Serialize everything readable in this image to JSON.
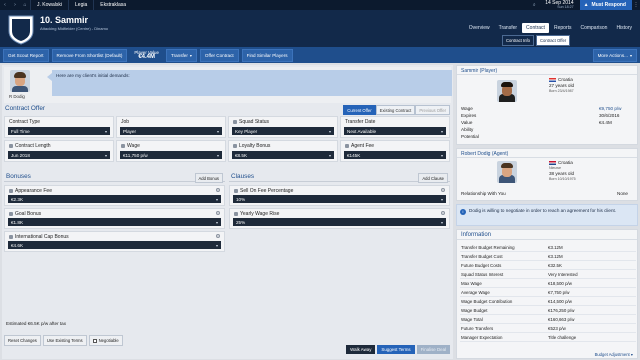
{
  "topbar": {
    "crumbs": [
      "J. Kowalski",
      "Legia",
      "Ekstraklasa"
    ],
    "date_line1": "14 Sep 2014",
    "date_line2": "Sun 18:27",
    "continue_label": "Must Respond",
    "continue_icon": "warning-icon"
  },
  "player": {
    "number": "10.",
    "name": "Sammir",
    "subtitle": "Attacking Midfielder (Centre) - Dinamo"
  },
  "tabs": [
    "Overview",
    "Transfer",
    "Contract",
    "Reports",
    "Comparison",
    "History"
  ],
  "active_tab": "Contract",
  "subtabs": [
    "Contract Info",
    "Contract Offer"
  ],
  "active_subtab": "Contract Offer",
  "toolbar": {
    "scout_report": "Get Scout Report",
    "remove_shortlist": "Remove From Shortlist (Default)",
    "player_value_label": "Player Value",
    "player_value": "€4.4M",
    "transfer": "Transfer",
    "offer_contract": "Offer Contract",
    "find_similar": "Find Similar Players",
    "more_actions": "More Actions..."
  },
  "agent_message": {
    "agent_short": "R Dodig",
    "text": "Here are my client's initial demands:"
  },
  "contract_offer": {
    "title": "Contract Offer",
    "offer_tabs": [
      "Current Offer",
      "Existing Contract",
      "Previous Offer"
    ],
    "active_offer_tab": "Current Offer",
    "fields": [
      {
        "label": "Contract Type",
        "value": "Full Time",
        "locked": false
      },
      {
        "label": "Job",
        "value": "Player",
        "locked": false
      },
      {
        "label": "Squad Status",
        "value": "Key Player",
        "locked": true
      },
      {
        "label": "Transfer Date",
        "value": "Next Available",
        "locked": false
      },
      {
        "label": "Contract Length",
        "value": "Jun 2018",
        "locked": true
      },
      {
        "label": "Wage",
        "value": "€11,750 p/w",
        "locked": true
      },
      {
        "label": "Loyalty Bonus",
        "value": "€8.5K",
        "locked": true
      },
      {
        "label": "Agent Fee",
        "value": "€145K",
        "locked": true
      }
    ]
  },
  "bonuses": {
    "title": "Bonuses",
    "add_label": "Add Bonus",
    "items": [
      {
        "label": "Appearance Fee",
        "value": "€2.3K"
      },
      {
        "label": "Goal Bonus",
        "value": "€1.8K"
      },
      {
        "label": "International Cap Bonus",
        "value": "€4.6K"
      }
    ]
  },
  "clauses": {
    "title": "Clauses",
    "add_label": "Add Clause",
    "items": [
      {
        "label": "Sell On Fee Percentage",
        "value": "10%"
      },
      {
        "label": "Yearly Wage Rise",
        "value": "25%"
      }
    ]
  },
  "bottom": {
    "estimate": "Estimated €6.5K p/w after tax",
    "reset": "Reset Changes",
    "use_existing": "Use Existing Terms",
    "negotiable": "Negotiable",
    "walk_away": "Walk Away",
    "suggest_terms": "Suggest Terms",
    "finalise": "Finalise Deal"
  },
  "player_card": {
    "title": "Sammir (Player)",
    "nation": "Croatia",
    "age": "27 years old",
    "born": "Born 23/4/1987",
    "rows": [
      {
        "k": "Wage",
        "v": "€9,750 p/w"
      },
      {
        "k": "Expires",
        "v": "30/6/2016"
      },
      {
        "k": "Value",
        "v": "€4.4M"
      },
      {
        "k": "Ability",
        "v": ""
      },
      {
        "k": "Potential",
        "v": ""
      }
    ]
  },
  "agent_card": {
    "title": "Robert Dodig (Agent)",
    "nation": "Croatia",
    "nationality_sub": "Nieuwe",
    "age": "38 years old",
    "born": "Born 10/10/1975",
    "relationship_label": "Relationship With You",
    "relationship_value": "None"
  },
  "info_banner": "Dodig is willing to negotiate in order to reach an agreement for his client.",
  "information": {
    "title": "Information",
    "rows": [
      {
        "k": "Transfer Budget Remaining",
        "v": "€3.12M"
      },
      {
        "k": "Transfer Budget Cost",
        "v": "€3.12M"
      },
      {
        "k": "Future Budget Costs",
        "v": "€32.5K"
      },
      {
        "k": "Squad Status Interest",
        "v": "Very Interested"
      },
      {
        "k": "Max Wage",
        "v": "€18,500 p/w"
      },
      {
        "k": "Average Wage",
        "v": "€7,750 p/w"
      },
      {
        "k": "Wage Budget Contribution",
        "v": "€14,500 p/w"
      },
      {
        "k": "Wage Budget",
        "v": "€176,250 p/w"
      },
      {
        "k": "Wage Total",
        "v": "€160,663 p/w"
      },
      {
        "k": "Future Transfers",
        "v": "€523 p/w"
      },
      {
        "k": "Manager Expectation",
        "v": "Title challenge"
      }
    ],
    "budget_adjust": "Budget Adjustment"
  },
  "colors": {
    "header_bg": "#12294a",
    "toolbar_bg": "#1f4e8c",
    "accent": "#2563b8",
    "field_bg": "#1e2a3a"
  }
}
